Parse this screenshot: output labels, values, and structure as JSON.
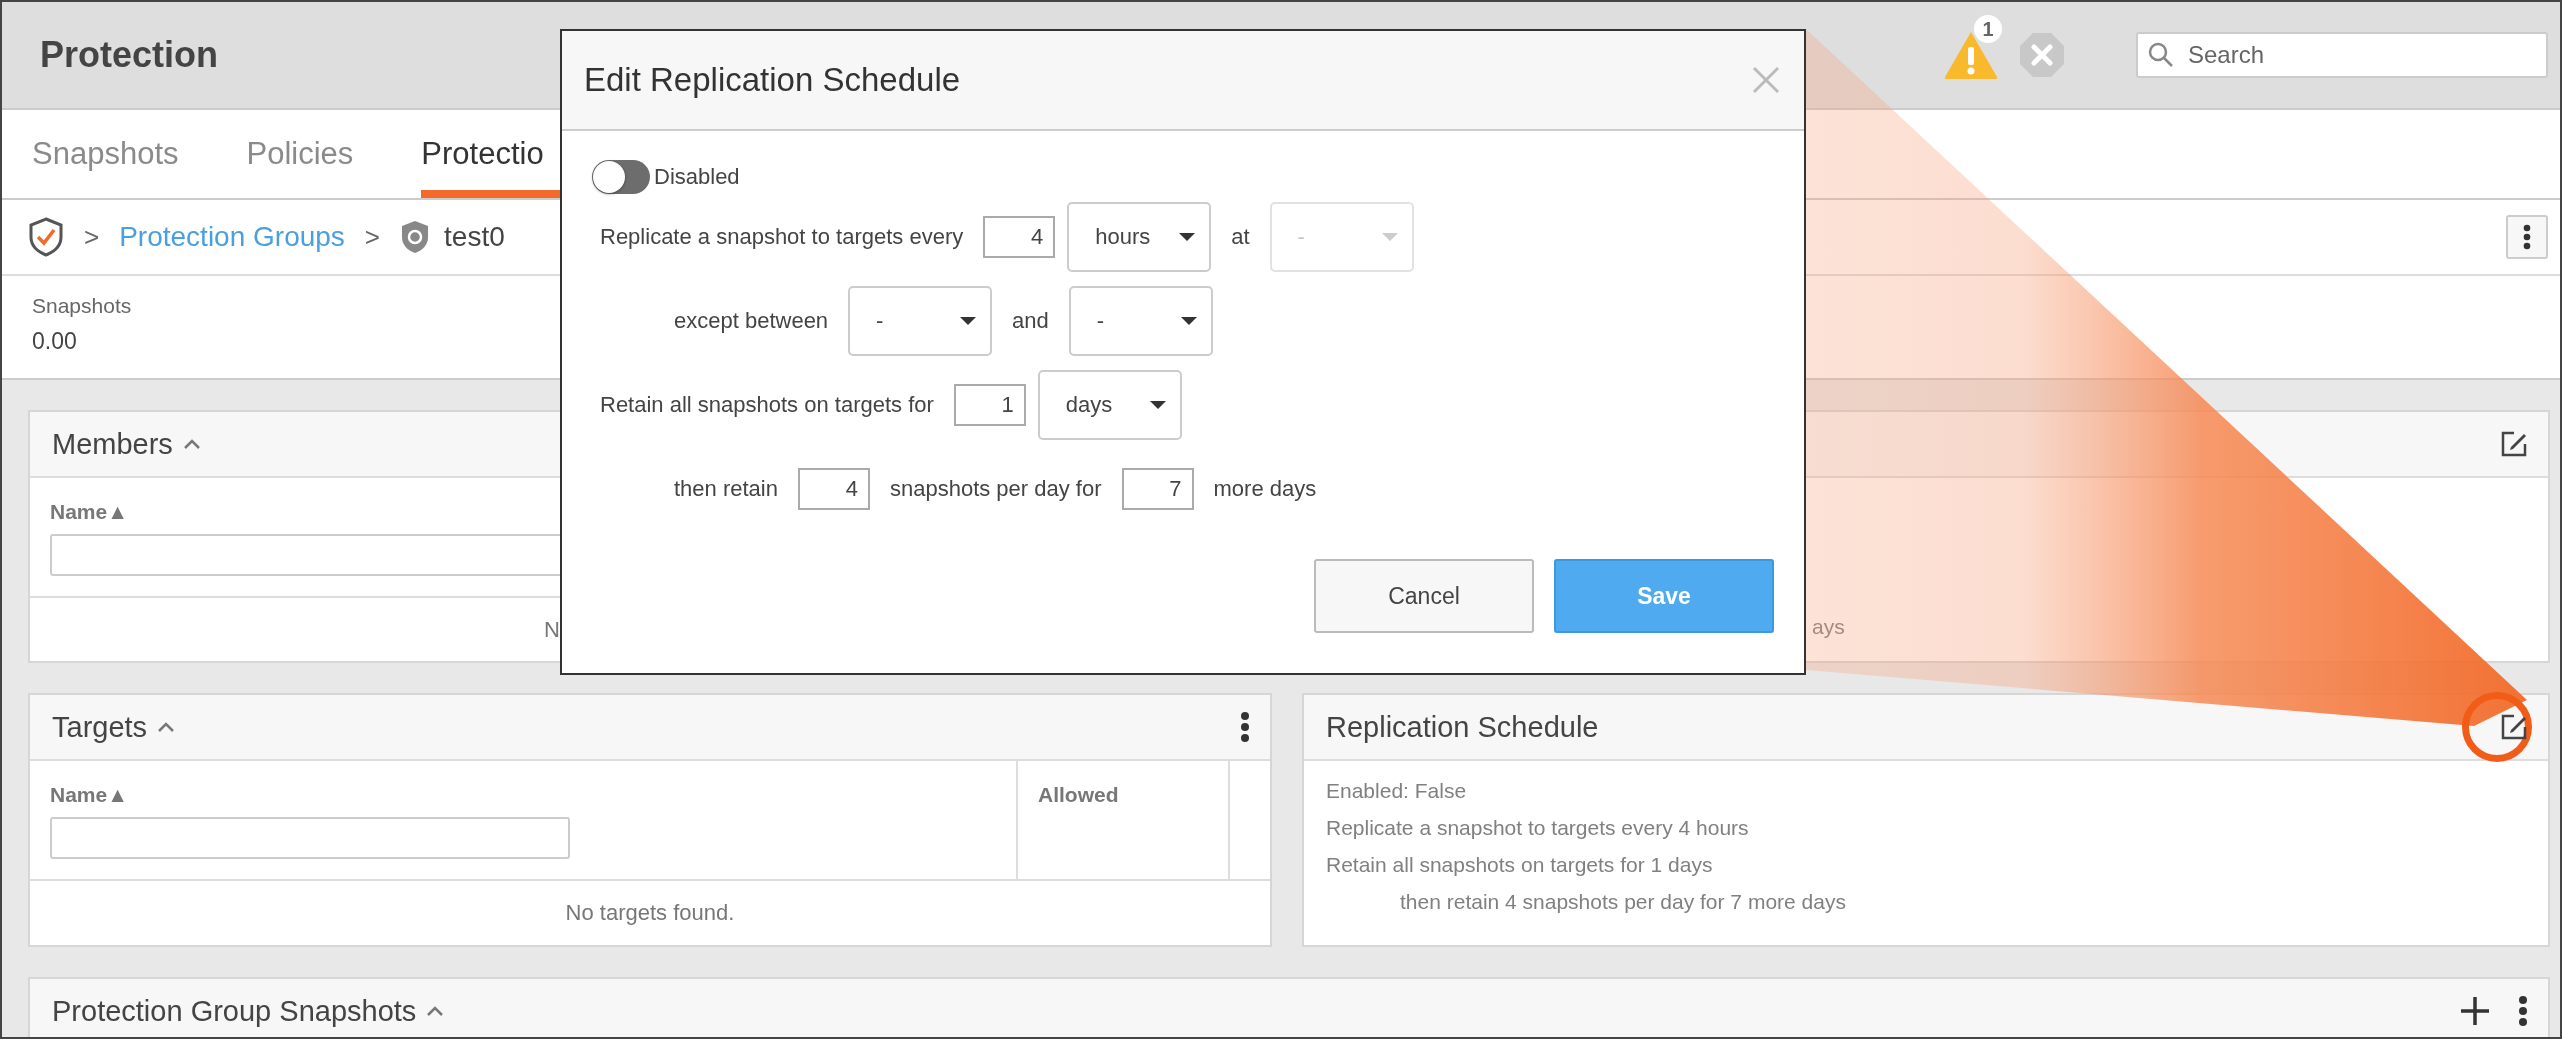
{
  "header": {
    "title": "Protection",
    "alert_count": "1",
    "search": {
      "placeholder": "Search"
    }
  },
  "tabs": [
    {
      "label": "Snapshots",
      "selected": false
    },
    {
      "label": "Policies",
      "selected": false
    },
    {
      "label": "Protectio",
      "selected": true
    }
  ],
  "breadcrumb": {
    "separator_1": ">",
    "link": "Protection Groups",
    "separator_2": ">",
    "current": "test0"
  },
  "stats": [
    {
      "label": "Snapshots",
      "value": "0.00"
    }
  ],
  "members": {
    "title": "Members",
    "column": "Name▲",
    "empty_text": "N"
  },
  "schedule_panel": {
    "visible_text": "ays"
  },
  "targets": {
    "title": "Targets",
    "columns": [
      "Name▲",
      "Allowed"
    ],
    "empty_text": "No targets found."
  },
  "replication_schedule": {
    "title": "Replication Schedule",
    "lines": [
      {
        "text": "Enabled: False",
        "indented": false
      },
      {
        "text": "Replicate a snapshot to targets every 4 hours",
        "indented": false
      },
      {
        "text": "Retain all snapshots on targets for 1 days",
        "indented": false
      },
      {
        "text": "then retain 4 snapshots per day for 7 more days",
        "indented": true
      }
    ]
  },
  "group_snapshots": {
    "title": "Protection Group Snapshots"
  },
  "dialog": {
    "title": "Edit Replication Schedule",
    "toggle": {
      "label": "Disabled",
      "on": false
    },
    "rows": [
      {
        "indented": false,
        "parts": [
          {
            "kind": "text",
            "text": "Replicate a snapshot to targets every"
          },
          {
            "kind": "input",
            "value": "4"
          },
          {
            "kind": "select",
            "value": "hours",
            "disabled": false
          },
          {
            "kind": "text",
            "text": "at"
          },
          {
            "kind": "select",
            "value": "-",
            "disabled": true
          }
        ]
      },
      {
        "indented": true,
        "parts": [
          {
            "kind": "text",
            "text": "except between"
          },
          {
            "kind": "select",
            "value": "-",
            "disabled": false
          },
          {
            "kind": "text",
            "text": "and"
          },
          {
            "kind": "select",
            "value": "-",
            "disabled": false
          }
        ]
      },
      {
        "indented": false,
        "parts": [
          {
            "kind": "text",
            "text": "Retain all snapshots on targets for"
          },
          {
            "kind": "input",
            "value": "1"
          },
          {
            "kind": "select",
            "value": "days",
            "disabled": false
          }
        ]
      },
      {
        "indented": true,
        "parts": [
          {
            "kind": "text",
            "text": "then retain"
          },
          {
            "kind": "input",
            "value": "4"
          },
          {
            "kind": "text",
            "text": "snapshots per day for"
          },
          {
            "kind": "input",
            "value": "7"
          },
          {
            "kind": "text",
            "text": "more days"
          }
        ]
      }
    ],
    "buttons": [
      {
        "label": "Cancel",
        "kind": "secondary"
      },
      {
        "label": "Save",
        "kind": "primary"
      }
    ]
  }
}
